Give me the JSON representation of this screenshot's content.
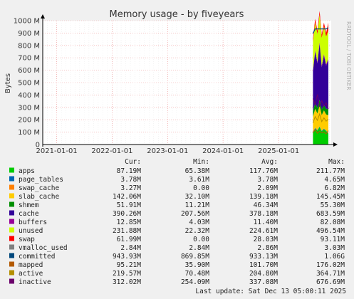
{
  "watermark": "RRDTOOL / TOBI OETIKER",
  "legend_headers": {
    "cur": "Cur:",
    "min": "Min:",
    "avg": "Avg:",
    "max": "Max:"
  },
  "last_update": "Last update: Sat Dec 13 05:00:11 2025",
  "chart_data": {
    "type": "area",
    "title": "Memory usage - by fiveyears",
    "ylabel": "Bytes",
    "ylim": [
      0,
      1000
    ],
    "y_ticks": [
      "0",
      "100 M",
      "200 M",
      "300 M",
      "400 M",
      "500 M",
      "600 M",
      "700 M",
      "800 M",
      "900 M",
      "1000 M"
    ],
    "x_ticks": [
      "2021-01-01",
      "2022-01-01",
      "2023-01-01",
      "2024-01-01",
      "2025-01-01"
    ],
    "x_range": [
      "2020-10-01",
      "2025-12-13"
    ],
    "data_start": "2025-08-15",
    "grid": true,
    "series": [
      {
        "name": "apps",
        "color": "#00cc00",
        "cur": "87.19M",
        "min": "65.38M",
        "avg": "117.76M",
        "max": "211.77M"
      },
      {
        "name": "page_tables",
        "color": "#0066b3",
        "cur": "3.78M",
        "min": "3.61M",
        "avg": "3.78M",
        "max": "4.65M"
      },
      {
        "name": "swap_cache",
        "color": "#ff8000",
        "cur": "3.27M",
        "min": "0.00",
        "avg": "2.09M",
        "max": "6.82M"
      },
      {
        "name": "slab_cache",
        "color": "#ffcc00",
        "cur": "142.06M",
        "min": "32.10M",
        "avg": "139.18M",
        "max": "145.45M"
      },
      {
        "name": "shmem",
        "color": "#330099",
        "cur": "51.91M",
        "min": "11.21M",
        "avg": "46.34M",
        "max": "55.30M"
      },
      {
        "name": "cache",
        "color": "#990099",
        "cur": "390.26M",
        "min": "207.56M",
        "avg": "378.18M",
        "max": "683.59M"
      },
      {
        "name": "buffers",
        "color": "#ccff00",
        "cur": "12.85M",
        "min": "4.03M",
        "avg": "11.40M",
        "max": "82.08M"
      },
      {
        "name": "unused",
        "color": "#ff0000",
        "cur": "231.88M",
        "min": "22.32M",
        "avg": "224.61M",
        "max": "496.54M"
      },
      {
        "name": "swap",
        "color": "#808080",
        "cur": "61.99M",
        "min": "0.00",
        "avg": "28.03M",
        "max": "93.11M"
      },
      {
        "name": "vmalloc_used",
        "color": "#008f00",
        "cur": "2.84M",
        "min": "2.84M",
        "avg": "2.86M",
        "max": "3.03M"
      },
      {
        "name": "committed",
        "color": "#00487d",
        "cur": "943.93M",
        "min": "869.85M",
        "avg": "933.13M",
        "max": "1.06G"
      },
      {
        "name": "mapped",
        "color": "#b35a00",
        "cur": "95.21M",
        "min": "35.90M",
        "avg": "101.70M",
        "max": "176.02M"
      },
      {
        "name": "active",
        "color": "#b38f00",
        "cur": "219.57M",
        "min": "70.48M",
        "avg": "204.80M",
        "max": "364.71M"
      },
      {
        "name": "inactive",
        "color": "#6b006b",
        "cur": "312.02M",
        "min": "254.09M",
        "avg": "337.08M",
        "max": "676.69M"
      }
    ],
    "legend_swatch_colors": [
      "#00cc00",
      "#0066b3",
      "#ff8000",
      "#ffcc00",
      "#008f00",
      "#330099",
      "#990099",
      "#ccff00",
      "#ff0000",
      "#808080",
      "#00487d",
      "#b35a00",
      "#b38f00",
      "#6b006b"
    ],
    "stack_plot_colors": {
      "apps": "#00cc00",
      "page_tables": "#0066b3",
      "swap_cache": "#ff8000",
      "slab_cache": "#ffcc00",
      "shmem": "#008f00",
      "cache": "#330099",
      "buffers": "#990099",
      "unused": "#ccff00",
      "swap": "#ff0000"
    }
  }
}
